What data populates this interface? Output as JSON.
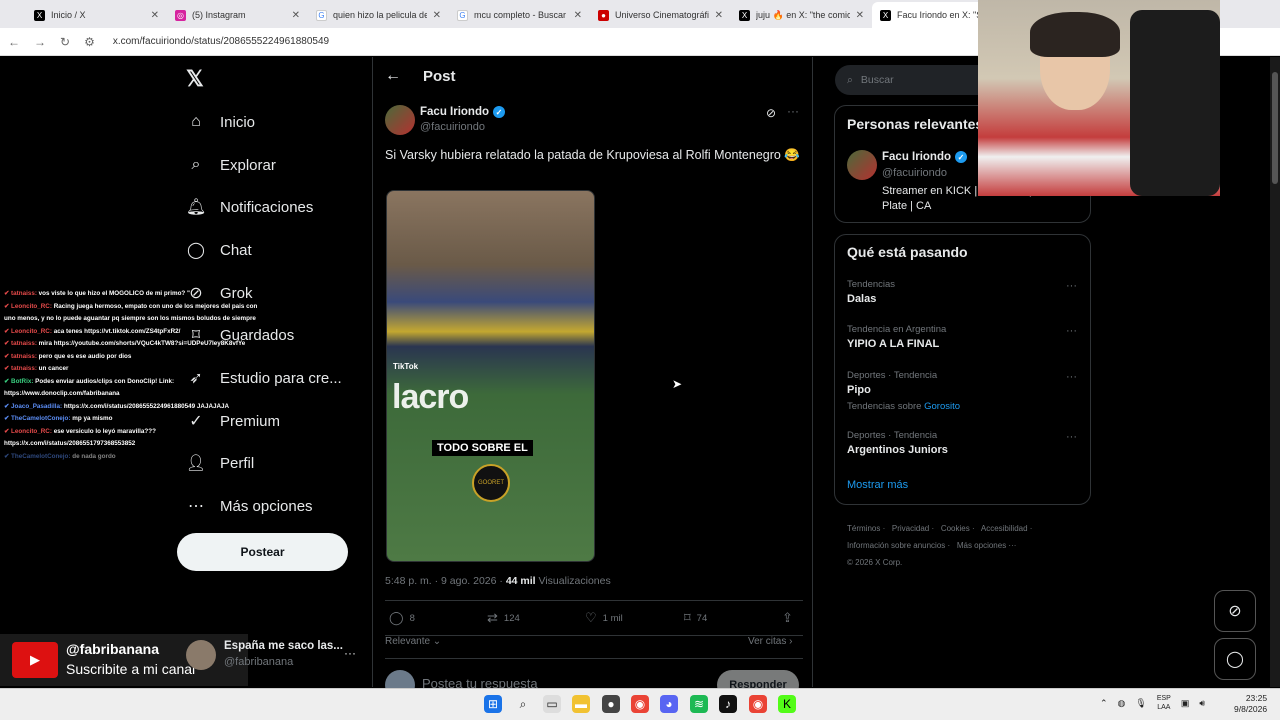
{
  "browser": {
    "tabs": [
      {
        "title": "Inicio / X",
        "icon": "x-icon"
      },
      {
        "title": "(5) Instagram",
        "icon": "instagram-icon"
      },
      {
        "title": "quien hizo la pelicula de e",
        "icon": "google-icon"
      },
      {
        "title": "mcu completo - Buscar cu",
        "icon": "google-icon"
      },
      {
        "title": "Universo Cinematográfico",
        "icon": "wiki-icon"
      },
      {
        "title": "juju 🔥 en X: \"the comic b",
        "icon": "x-icon"
      },
      {
        "title": "Facu Iriondo en X: \"Si",
        "icon": "x-icon"
      }
    ],
    "url": "x.com/facuiriondo/status/2086555224961880549"
  },
  "nav": {
    "logo": "𝕏",
    "items": [
      {
        "label": "Inicio",
        "icon": "home-icon"
      },
      {
        "label": "Explorar",
        "icon": "search-icon"
      },
      {
        "label": "Notificaciones",
        "icon": "bell-icon"
      },
      {
        "label": "Chat",
        "icon": "chat-icon"
      },
      {
        "label": "Grok",
        "icon": "grok-icon"
      },
      {
        "label": "Guardados",
        "icon": "bookmark-icon"
      },
      {
        "label": "Estudio para cre...",
        "icon": "rocket-icon"
      },
      {
        "label": "Premium",
        "icon": "verified-icon"
      },
      {
        "label": "Perfil",
        "icon": "user-icon"
      },
      {
        "label": "Más opciones",
        "icon": "more-icon"
      }
    ],
    "post_button": "Postear"
  },
  "stream_chat": [
    {
      "user": "tatnaiss",
      "msg": "vos viste lo que hizo el MOGOLICO de mi primo? \"",
      "color": "red"
    },
    {
      "user": "Leoncito_RC",
      "msg": "Racing juega hermoso, empato con uno de los mejores del pais con",
      "color": "red"
    },
    {
      "user": "",
      "msg": "uno menos, y no lo puede aguantar pq siempre son los mismos boludos de siempre",
      "color": ""
    },
    {
      "user": "Leoncito_RC",
      "msg": "aca tenes https://vt.tiktok.com/ZS4tpFxR2/",
      "color": "red"
    },
    {
      "user": "tatnaiss",
      "msg": "mira https://youtube.com/shorts/VQuC4kTW8?si=UDPeU7Iey8K8vfYe",
      "color": "red"
    },
    {
      "user": "tatnaiss",
      "msg": "pero que es ese audio por dios",
      "color": "red"
    },
    {
      "user": "tatnaiss",
      "msg": "un cancer",
      "color": "red"
    },
    {
      "user": "BotRix",
      "msg": "Podes enviar audios/clips con DonoClip! Link:",
      "color": "green"
    },
    {
      "user": "",
      "msg": "https://www.donoclip.com/fabribanana",
      "color": ""
    },
    {
      "user": "Joaco_Pasadilla",
      "msg": "https://x.com/i/status/2086555224961880549 JAJAJAJA",
      "color": "blue"
    },
    {
      "user": "TheCamelotConejo",
      "msg": "mp ya mismo",
      "color": "blue"
    },
    {
      "user": "Leoncito_RC",
      "msg": "ese versiculo lo leyó maravilla???",
      "color": "red"
    },
    {
      "user": "",
      "msg": "https://x.com/i/status/2086551797368553852",
      "color": ""
    },
    {
      "user": "TheCamelotConejo",
      "msg": "de nada gordo",
      "color": "blue"
    }
  ],
  "post": {
    "header_title": "Post",
    "author_name": "Facu Iriondo",
    "author_handle": "@facuiriondo",
    "text": "Si Varsky hubiera relatado la patada de Krupoviesa al Rolfi Montenegro 😂",
    "media_caption": "TODO SOBRE EL",
    "media_logo": "GOORET",
    "media_watermark": "TikTok",
    "media_banner": "lacro",
    "timestamp": "5:48 p. m. · 9 ago. 2026 ·",
    "views": "44 mil",
    "views_label": "Visualizaciones",
    "stats": {
      "replies": "8",
      "reposts": "124",
      "likes": "1 mil",
      "bookmarks": "74"
    },
    "relevant_label": "Relevante",
    "quotes_label": "Ver citas",
    "reply_placeholder": "Postea tu respuesta",
    "reply_button": "Responder"
  },
  "sidebar": {
    "search_placeholder": "Buscar",
    "relevant_title": "Personas relevantes",
    "relevant_person": {
      "name": "Facu Iriondo",
      "handle": "@facuiriondo",
      "bio": "Streamer en KICK | D... ATFA | River Plate | CA"
    },
    "trends_title": "Qué está pasando",
    "trends": [
      {
        "category": "Tendencias",
        "name": "Dalas",
        "sub": ""
      },
      {
        "category": "Tendencia en Argentina",
        "name": "YIPIO A LA FINAL",
        "sub": ""
      },
      {
        "category": "Deportes · Tendencia",
        "name": "Pipo",
        "sub": "Tendencias sobre",
        "sub_link": "Gorosito"
      },
      {
        "category": "Deportes · Tendencia",
        "name": "Argentinos Juniors",
        "sub": ""
      }
    ],
    "show_more": "Mostrar más",
    "footer": [
      "Términos",
      "Privacidad",
      "Cookies",
      "Accesibilidad",
      "Información sobre anuncios",
      "Más opciones ···",
      "© 2026 X Corp."
    ]
  },
  "overlay": {
    "yt_handle": "@fabribanana",
    "yt_sub": "Suscribite a mi canal",
    "yt_account_name": "España me saco las...",
    "yt_account_handle": "@fabribanana"
  },
  "taskbar": {
    "lang": "ESP",
    "lang2": "LAA",
    "time": "23:25",
    "date": "9/8/2026"
  }
}
